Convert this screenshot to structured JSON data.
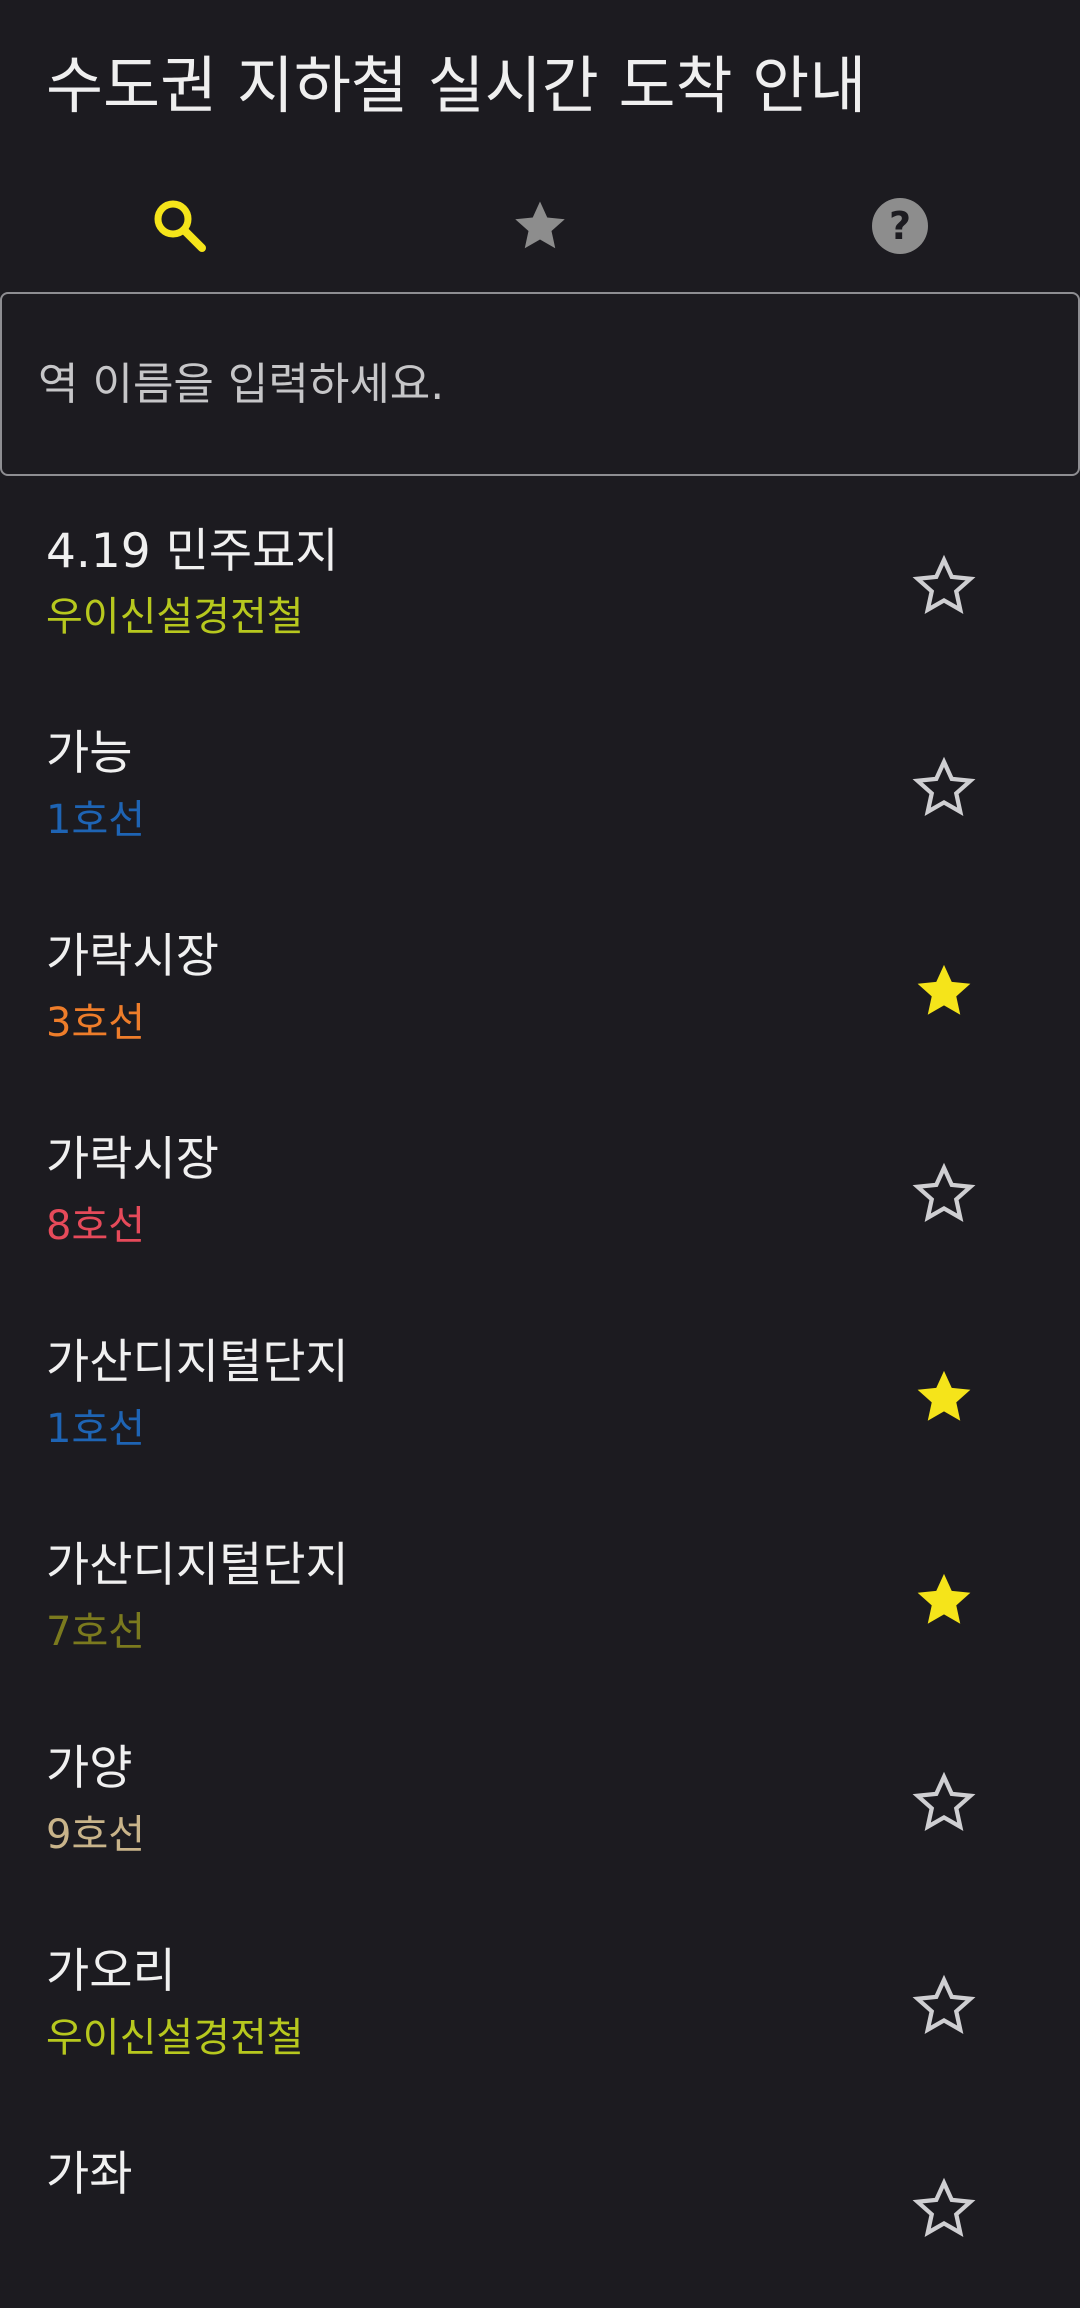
{
  "app": {
    "title": "수도권 지하철 실시간 도착 안내"
  },
  "tabs": [
    {
      "name": "search",
      "icon": "search-icon",
      "active": true
    },
    {
      "name": "favorites",
      "icon": "star-icon",
      "active": false
    },
    {
      "name": "help",
      "icon": "help-icon",
      "active": false
    }
  ],
  "search": {
    "placeholder": "역 이름을 입력하세요.",
    "value": ""
  },
  "colors": {
    "accent": "#f5e41a",
    "inactive_icon": "#8d8d8d",
    "star_outline": "#cfcfd2"
  },
  "stations": [
    {
      "name": "4.19 민주묘지",
      "line": "우이신설경전철",
      "line_color": "#b7c81e",
      "favorite": false
    },
    {
      "name": "가능",
      "line": "1호선",
      "line_color": "#1e64b4",
      "favorite": false
    },
    {
      "name": "가락시장",
      "line": "3호선",
      "line_color": "#ee7d2a",
      "favorite": true
    },
    {
      "name": "가락시장",
      "line": "8호선",
      "line_color": "#e64a5a",
      "favorite": false
    },
    {
      "name": "가산디지털단지",
      "line": "1호선",
      "line_color": "#1e64b4",
      "favorite": true
    },
    {
      "name": "가산디지털단지",
      "line": "7호선",
      "line_color": "#7b7a1e",
      "favorite": true
    },
    {
      "name": "가양",
      "line": "9호선",
      "line_color": "#c9b48a",
      "favorite": false
    },
    {
      "name": "가오리",
      "line": "우이신설경전철",
      "line_color": "#b7c81e",
      "favorite": false
    },
    {
      "name": "가좌",
      "line": "",
      "line_color": "#1e64b4",
      "favorite": false
    }
  ]
}
